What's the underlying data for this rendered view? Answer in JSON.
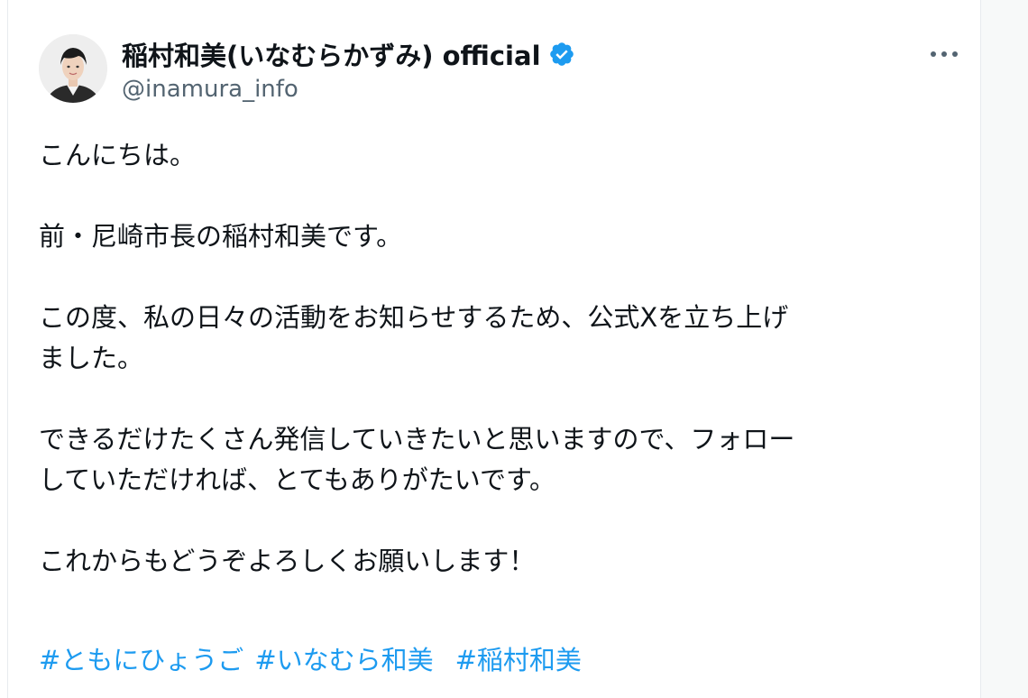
{
  "post": {
    "author": {
      "display_name": "稲村和美(いなむらかずみ) official",
      "handle": "@inamura_info",
      "verified": true
    },
    "more_label": "···",
    "body": {
      "p1": "こんにちは。",
      "p2": "前・尼崎市長の稲村和美です。",
      "p3_l1": "この度、私の日々の活動をお知らせするため、公式Xを立ち上げ",
      "p3_l2": "ました。",
      "p4_l1": "できるだけたくさん発信していきたいと思いますので、フォロー",
      "p4_l2": "していただければ、とてもありがたいです。",
      "p5": "これからもどうぞよろしくお願いします！"
    },
    "hashtags": [
      "#ともにひょうご",
      "#いなむら和美",
      "#稲村和美"
    ]
  },
  "colors": {
    "link": "#1d9bf0",
    "verified_badge": "#1d9bf0",
    "text": "#0f1419",
    "secondary_text": "#536471"
  },
  "icons": {
    "verified": "verified-badge-icon",
    "more": "more-horizontal-icon",
    "avatar": "profile-photo"
  }
}
